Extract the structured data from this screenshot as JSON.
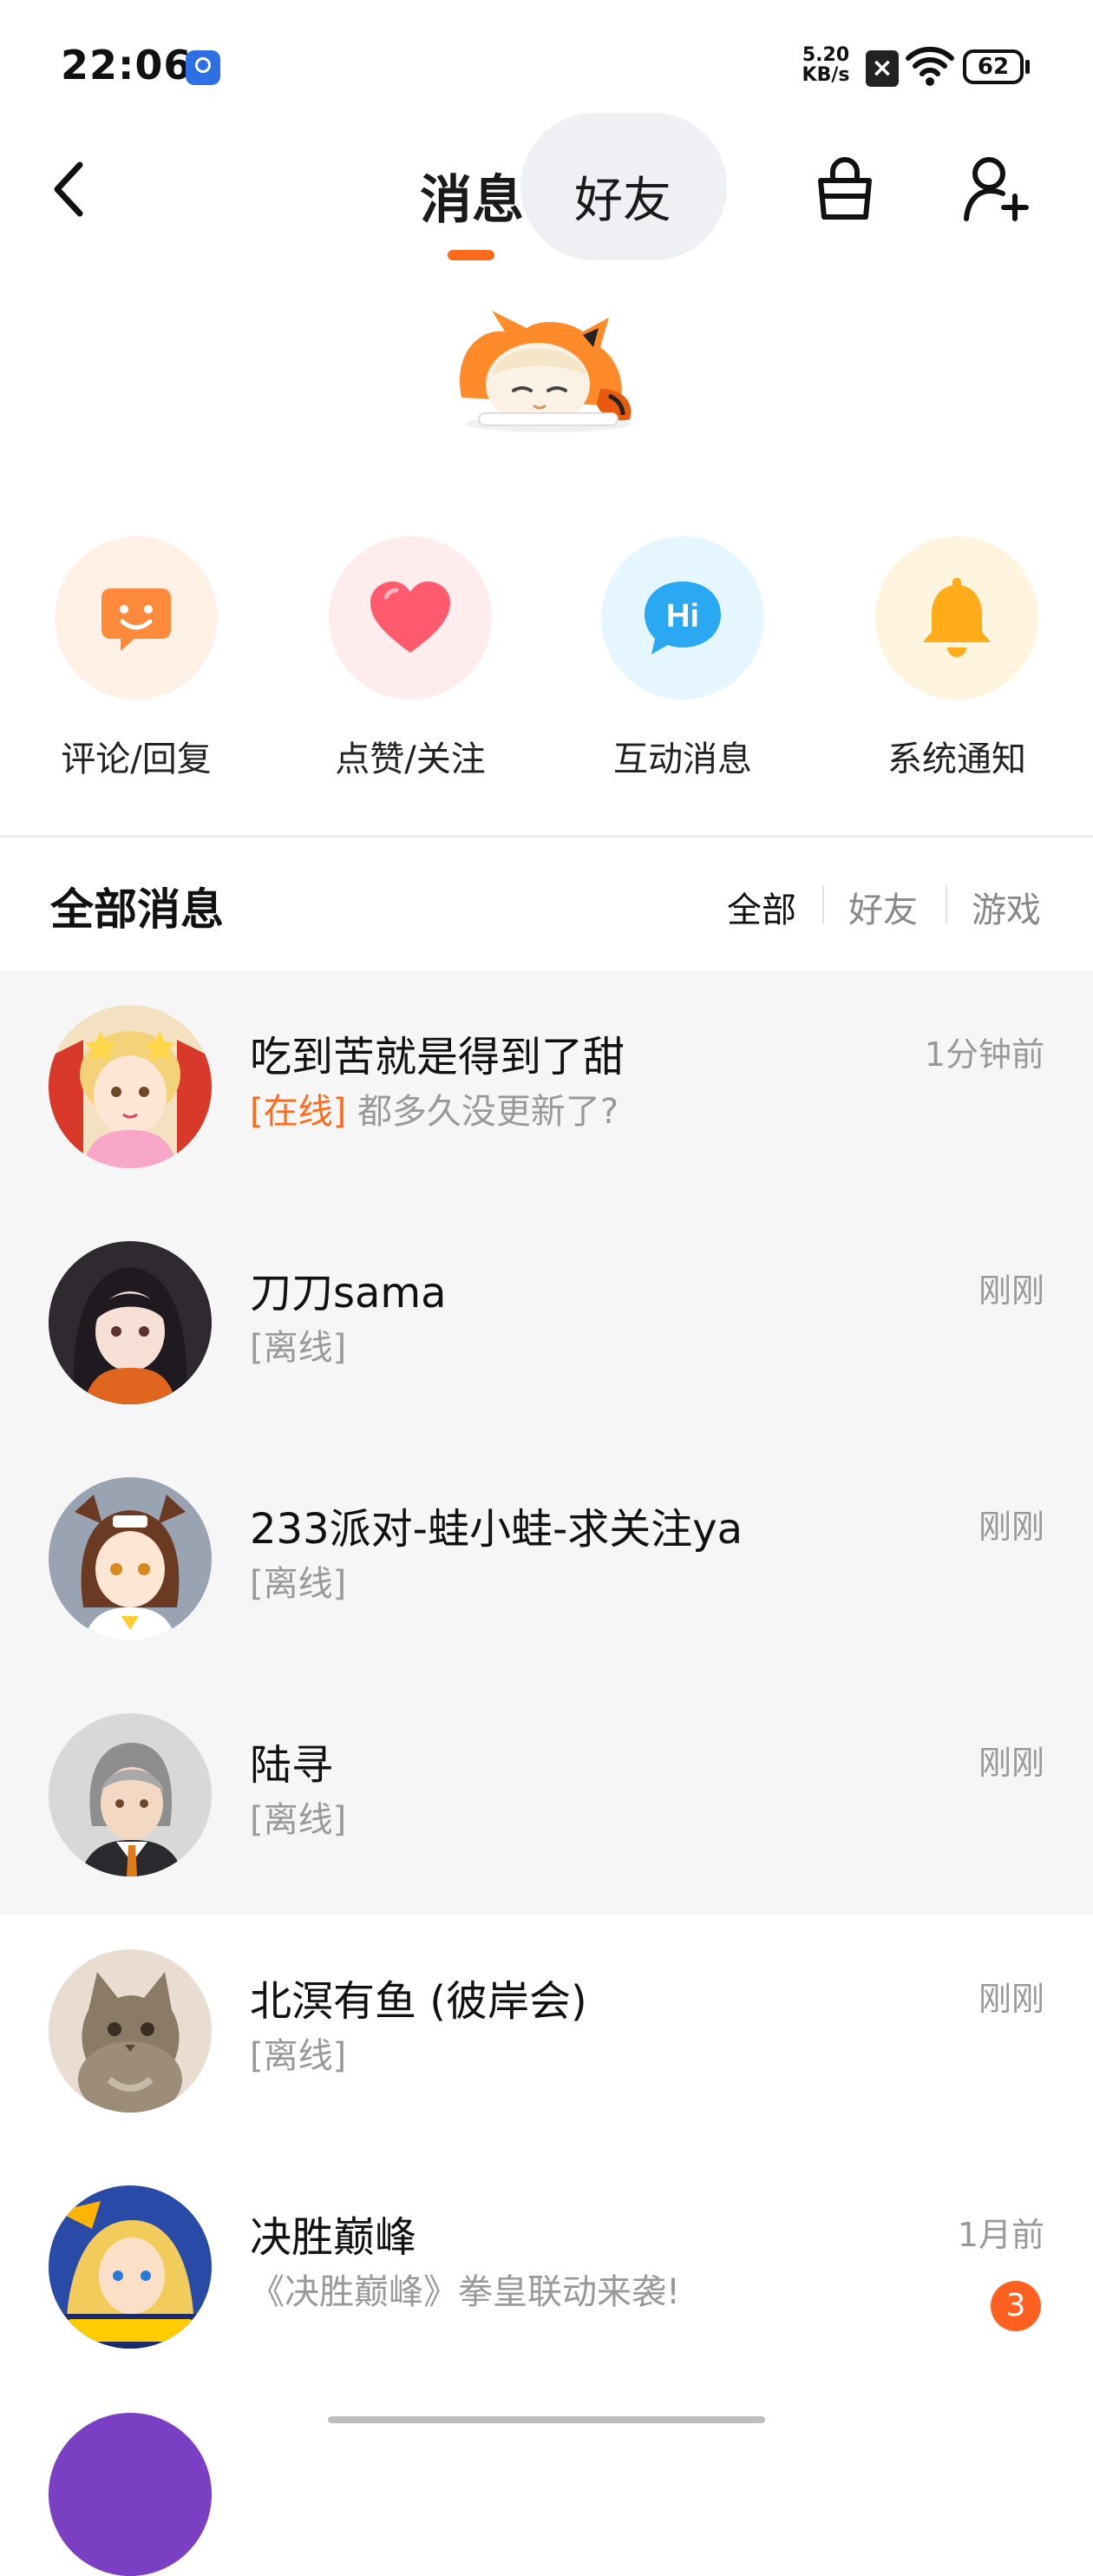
{
  "status_bar": {
    "time": "22:06",
    "net_speed_value": "5.20",
    "net_speed_unit": "KB/s",
    "battery": "62"
  },
  "nav": {
    "tab_messages": "消息",
    "tab_friends": "好友"
  },
  "categories": [
    {
      "label": "评论/回复",
      "icon": "comment-face-icon",
      "bg": "#fff1e6",
      "color": "#ff8a3c"
    },
    {
      "label": "点赞/关注",
      "icon": "heart-icon",
      "bg": "#ffecec",
      "color": "#ff5a6e"
    },
    {
      "label": "互动消息",
      "icon": "hi-bubble-icon",
      "bg": "#e6f6ff",
      "color": "#2aa8f2"
    },
    {
      "label": "系统通知",
      "icon": "bell-icon",
      "bg": "#fff4dd",
      "color": "#ffab1a"
    }
  ],
  "section": {
    "title": "全部消息",
    "filters": [
      "全部",
      "好友",
      "游戏"
    ],
    "active_filter": "全部"
  },
  "messages": [
    {
      "name": "吃到苦就是得到了甜",
      "status": "[在线]",
      "preview": "都多久没更新了?",
      "time": "1分钟前",
      "online": true
    },
    {
      "name": "刀刀sama",
      "status": "[离线]",
      "preview": "",
      "time": "刚刚",
      "online": false
    },
    {
      "name": "233派对-蛙小蛙-求关注ya",
      "status": "[离线]",
      "preview": "",
      "time": "刚刚",
      "online": false
    },
    {
      "name": "陆寻",
      "status": "[离线]",
      "preview": "",
      "time": "刚刚",
      "online": false
    },
    {
      "name": "北溟有鱼 (彼岸会)",
      "status": "[离线]",
      "preview": "",
      "time": "刚刚",
      "online": false
    },
    {
      "name": "决胜巅峰",
      "status": "",
      "preview": "《决胜巅峰》拳皇联动来袭!",
      "time": "1月前",
      "badge": "3"
    }
  ],
  "colors": {
    "accent": "#ff6a1a",
    "badge": "#ff6020"
  }
}
